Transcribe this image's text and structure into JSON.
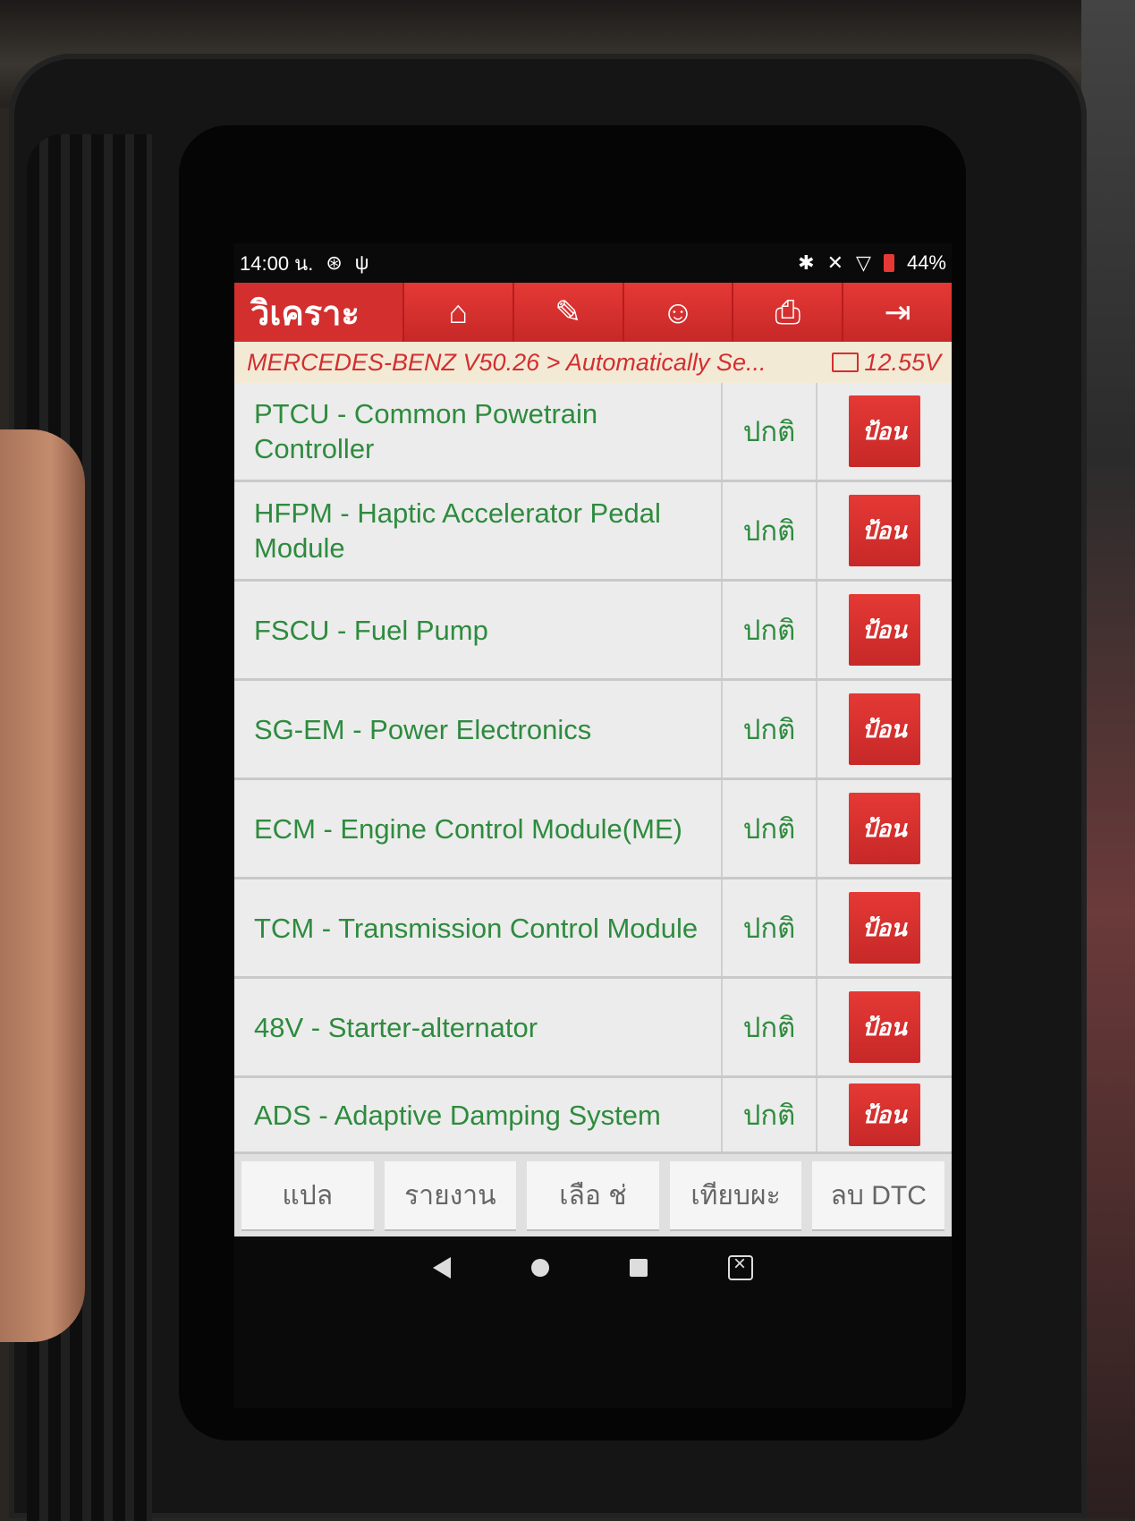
{
  "status_bar": {
    "time": "14:00 น.",
    "icons_left": [
      "alarm-icon",
      "usb-icon"
    ],
    "icons_right": [
      "bluetooth-icon",
      "mute-icon",
      "wifi-icon"
    ],
    "battery": "44%"
  },
  "top_bar": {
    "title": "วิเคราะ",
    "buttons": [
      {
        "name": "home",
        "glyph": "⌂"
      },
      {
        "name": "edit",
        "glyph": "✎"
      },
      {
        "name": "user",
        "glyph": "☺"
      },
      {
        "name": "print",
        "glyph": "⎙"
      },
      {
        "name": "exit",
        "glyph": "⇥"
      }
    ]
  },
  "path": {
    "breadcrumb": "MERCEDES-BENZ V50.26 > Automatically Se...",
    "voltage": "12.55V"
  },
  "modules": [
    {
      "name": "PTCU - Common Powetrain Controller",
      "status": "ปกติ",
      "action": "ป้อน"
    },
    {
      "name": "HFPM - Haptic Accelerator Pedal Module",
      "status": "ปกติ",
      "action": "ป้อน"
    },
    {
      "name": "FSCU - Fuel Pump",
      "status": "ปกติ",
      "action": "ป้อน"
    },
    {
      "name": "SG-EM - Power Electronics",
      "status": "ปกติ",
      "action": "ป้อน"
    },
    {
      "name": "ECM - Engine Control Module(ME)",
      "status": "ปกติ",
      "action": "ป้อน"
    },
    {
      "name": "TCM - Transmission Control Module",
      "status": "ปกติ",
      "action": "ป้อน"
    },
    {
      "name": "48V - Starter-alternator",
      "status": "ปกติ",
      "action": "ป้อน"
    },
    {
      "name": "ADS - Adaptive Damping System",
      "status": "ปกติ",
      "action": "ป้อน"
    }
  ],
  "bottom_buttons": [
    "แปล",
    "รายงาน",
    "เลือ   ช่",
    "เทียบผะ",
    "ลบ DTC"
  ],
  "colors": {
    "accent": "#d32f2f",
    "text_green": "#2e8b3e"
  }
}
